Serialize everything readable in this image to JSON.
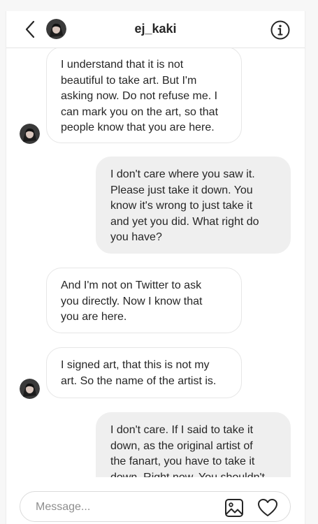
{
  "header": {
    "username": "ej_kaki",
    "back_icon": "chevron-left-icon",
    "info_icon": "info-icon"
  },
  "messages": [
    {
      "direction": "in",
      "lines": [
        "I understand that it is not",
        "beautiful to take art. But I'm",
        "asking now. Do not refuse me. I",
        "can mark you on the art, so that",
        "people know that you are here."
      ],
      "show_avatar": true
    },
    {
      "direction": "out",
      "lines": [
        "I don't care where you saw it.",
        "Please just take it down. You",
        "know it's wrong to just take it",
        "and yet you did. What right do",
        "you have?"
      ],
      "show_avatar": false
    },
    {
      "direction": "in",
      "lines": [
        "And I'm not on Twitter to ask",
        "you directly. Now I know that",
        "you are here."
      ],
      "show_avatar": false
    },
    {
      "direction": "in",
      "lines": [
        "I signed art, that this is not my",
        "art. So the name of the artist is."
      ],
      "show_avatar": true
    },
    {
      "direction": "out",
      "lines": [
        "I don't care. If I said to take it",
        "down, as the original artist of",
        "the fanart, you have to take it",
        "down. Right now. You shouldn't"
      ],
      "show_avatar": false
    }
  ],
  "composer": {
    "placeholder": "Message...",
    "image_icon": "image-icon",
    "like_icon": "heart-icon"
  },
  "colors": {
    "incoming_bubble_bg": "#ffffff",
    "incoming_bubble_border": "#e6e6e6",
    "outgoing_bubble_bg": "#efefef",
    "text": "#262626",
    "placeholder": "#8e8e8e"
  }
}
